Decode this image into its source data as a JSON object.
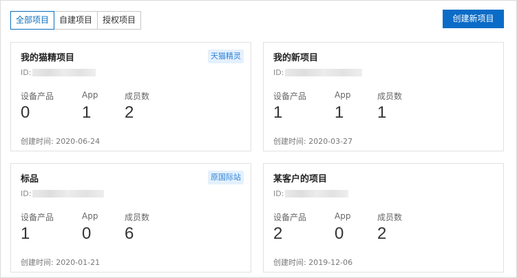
{
  "tabs": [
    {
      "label": "全部项目",
      "active": true
    },
    {
      "label": "自建项目",
      "active": false
    },
    {
      "label": "授权项目",
      "active": false
    }
  ],
  "create_button": "创建新项目",
  "stat_labels": {
    "products": "设备产品",
    "app": "App",
    "members": "成员数"
  },
  "cards": [
    {
      "title": "我的猫精项目",
      "tag": "天猫精灵",
      "id_label": "ID:",
      "products": "0",
      "app": "1",
      "members": "2",
      "created": "创建时间: 2020-06-24"
    },
    {
      "title": "我的新项目",
      "tag": "",
      "id_label": "ID:",
      "products": "1",
      "app": "1",
      "members": "1",
      "created": "创建时间: 2020-03-27"
    },
    {
      "title": "标品",
      "tag": "原国际站",
      "id_label": "ID:",
      "products": "1",
      "app": "0",
      "members": "6",
      "created": "创建时间: 2020-01-21"
    },
    {
      "title": "某客户的项目",
      "tag": "",
      "id_label": "ID:",
      "products": "2",
      "app": "0",
      "members": "2",
      "created": "创建时间: 2019-12-06"
    }
  ],
  "colors": {
    "accent": "#0b6cc7",
    "tag_bg": "#e4f0fd",
    "tag_text": "#2e83d6"
  }
}
